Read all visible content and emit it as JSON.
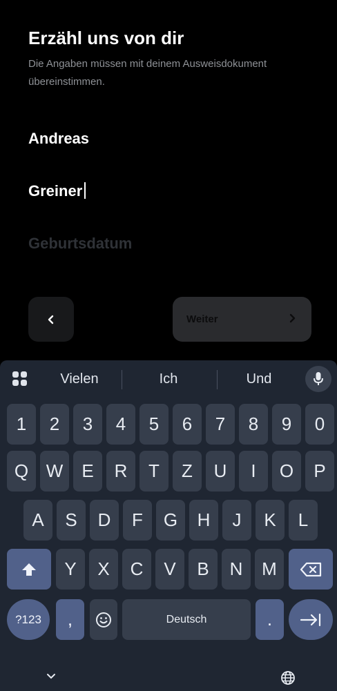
{
  "header": {
    "title": "Erzähl uns von dir",
    "subtitle": "Die Angaben müssen mit deinem Ausweisdokument übereinstimmen."
  },
  "form": {
    "first_name": "Andreas",
    "last_name": "Greiner",
    "birthdate_placeholder": "Geburtsdatum"
  },
  "nav": {
    "back_icon": "chevron-left-icon",
    "next_label": "Weiter",
    "next_icon": "chevron-right-icon"
  },
  "keyboard": {
    "suggestions": [
      "Vielen",
      "Ich",
      "Und"
    ],
    "row_numbers": [
      "1",
      "2",
      "3",
      "4",
      "5",
      "6",
      "7",
      "8",
      "9",
      "0"
    ],
    "row_qwertz": [
      "Q",
      "W",
      "E",
      "R",
      "T",
      "Z",
      "U",
      "I",
      "O",
      "P"
    ],
    "row_asdf": [
      "A",
      "S",
      "D",
      "F",
      "G",
      "H",
      "J",
      "K",
      "L"
    ],
    "row_yxcv": [
      "Y",
      "X",
      "C",
      "V",
      "B",
      "N",
      "M"
    ],
    "symbols_label": "?123",
    "comma_label": ",",
    "period_label": ".",
    "space_label": "Deutsch",
    "colors": {
      "background": "#1f2632",
      "key": "#363e4c",
      "modifier": "#51618a"
    }
  }
}
